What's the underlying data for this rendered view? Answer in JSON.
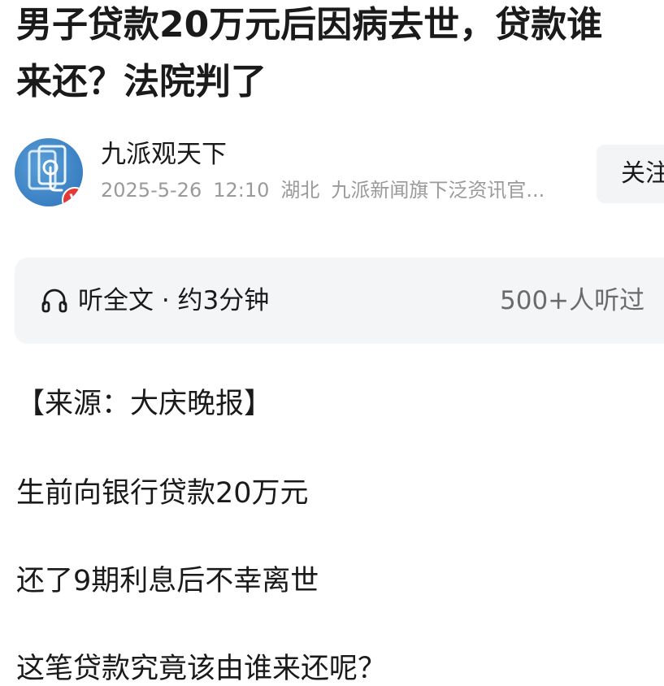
{
  "article": {
    "title_line1": "男子贷款20万元后因病去世，贷款谁",
    "title_line2": "来还？法院判了"
  },
  "author": {
    "name": "九派观天下",
    "date": "2025-5-26",
    "time": "12:10",
    "location": "湖北",
    "description": "九派新闻旗下泛资讯官...",
    "verified_badge": "V",
    "follow_label": "关注"
  },
  "listen": {
    "label": "听全文 · 约3分钟",
    "count": "500+人听过"
  },
  "body": {
    "paragraphs": [
      "【来源：大庆晚报】",
      "生前向银行贷款20万元",
      "还了9期利息后不幸离世",
      "这笔贷款究竟该由谁来还呢？"
    ]
  },
  "colors": {
    "verified_badge": "#e53935",
    "avatar": "#3a7fc2",
    "meta_text": "#9a9a9a",
    "listen_bar_bg": "#f4f5f7"
  },
  "icons": {
    "avatar": "tablet-touch-logo",
    "listen": "headphones-icon"
  }
}
